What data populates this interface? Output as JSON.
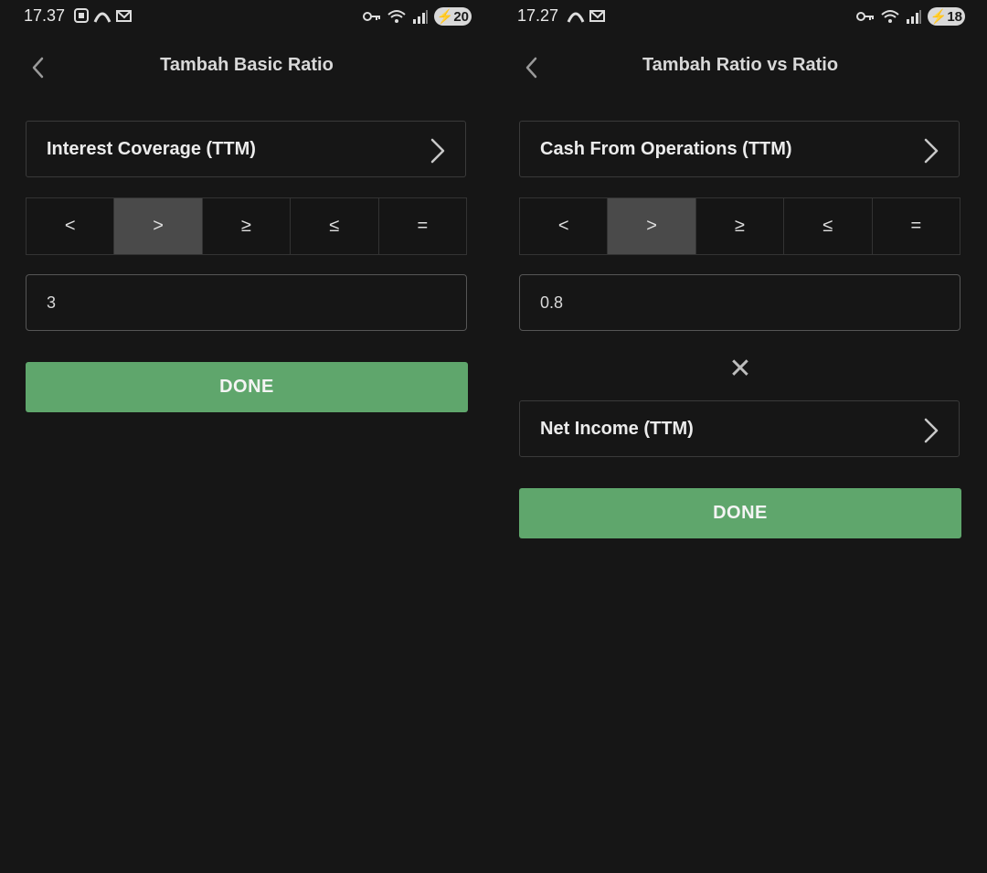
{
  "left": {
    "status": {
      "time": "17.37",
      "battery": "20"
    },
    "title": "Tambah Basic Ratio",
    "metric": "Interest Coverage (TTM)",
    "operators": [
      "<",
      ">",
      "≥",
      "≤",
      "="
    ],
    "selected_operator": ">",
    "value": "3",
    "done_label": "DONE"
  },
  "right": {
    "status": {
      "time": "17.27",
      "battery": "18"
    },
    "title": "Tambah Ratio vs Ratio",
    "metric": "Cash From Operations (TTM)",
    "operators": [
      "<",
      ">",
      "≥",
      "≤",
      "="
    ],
    "selected_operator": ">",
    "value": "0.8",
    "multiplier_symbol": "✕",
    "second_metric": "Net Income (TTM)",
    "done_label": "DONE"
  },
  "colors": {
    "background": "#161616",
    "accent_green": "#5fa66c",
    "selected_op": "#4a4a4a"
  }
}
